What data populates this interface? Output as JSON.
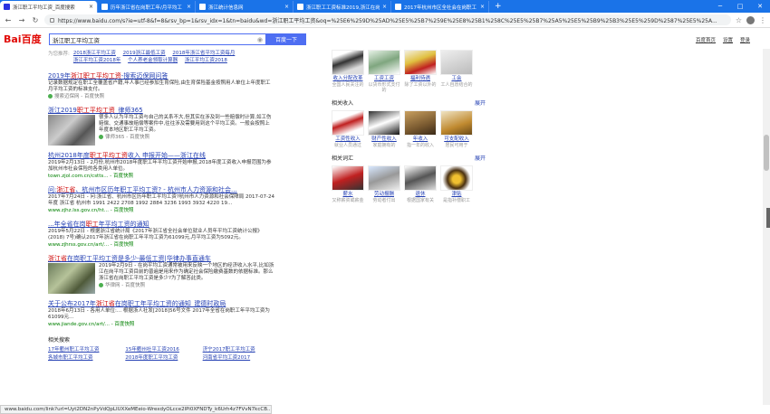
{
  "tabs": [
    {
      "title": "浙江职工平均工资_百度搜索",
      "active": true
    },
    {
      "title": "历年浙江省在岗职工年/月平均工",
      "active": false
    },
    {
      "title": "浙江统计信息网",
      "active": false
    },
    {
      "title": "浙江职工工资标准2019,浙江在岗",
      "active": false
    },
    {
      "title": "2017年杭州市区全社会在岗职工",
      "active": false
    }
  ],
  "new_tab": "+",
  "address": {
    "url": "https://www.baidu.com/s?ie=utf-8&f=8&rsv_bp=1&rsv_idx=1&tn=baidu&wd=浙江职工平均工资&oq=%25E6%259D%25AD%25E5%25B7%259E%25E8%25B1%258C%25E5%25B7%25A5%25E5%25B9%25B3%25E5%259D%2587%25E5%25A..."
  },
  "search": {
    "logo": "Bai百度",
    "query": "浙江职工平均工资",
    "button": "百度一下",
    "header_links": [
      "百度首页",
      "设置",
      "登录"
    ]
  },
  "related_top": {
    "label": "为您推荐:",
    "links": [
      "2018浙江平均工资",
      "2019浙江最低工资",
      "2018年浙江省平均工资每月",
      "浙江平均工资2018年",
      "个人养老金领取计算器",
      "浙江平均工资2018"
    ]
  },
  "results": [
    {
      "title_pre": "2019年",
      "title_em": "浙江职工平均工资",
      "title_post": "-搜索迈保网问答",
      "desc": "记录数据规定在职工全覆盖省户籍,年人事已经参加生育保险,由生育保险基金按照用人单位上年度职工月平均工资的标准支付。",
      "meta": "搜索迈保网 - 百度快照",
      "thumb": ""
    },
    {
      "title_pre": "浙江2019",
      "title_em": "职工平均工资",
      "title_post": "_律师365",
      "desc": "很多人认为平均工资与自己的关系不大,但其实在涉及到一些赔偿时计算,如工伤赔偿、交通事故赔偿等案件中,往往涉及需要用到这个平均工资。一般会按照上年度本地区职工平均工资。",
      "meta": "律师365 - 百度快照",
      "thumb": "a"
    },
    {
      "title_pre": "杭州2018年度",
      "title_em": "职工平均工资",
      "title_post": "收入 申报开始——浙江在线",
      "desc": "2019年2月13日 - 2月份,杭州市2018年度职工年平均工资开始申报,2018年度工资收入申报范围为参加杭州市社会保险的各类用人单位。",
      "meta": "town.zjol.com.cn/cstts... - 百度快照",
      "thumb": ""
    },
    {
      "title_pre": "问:",
      "title_em": "浙江省",
      "title_post": "、杭州市区历年职工平均工资? - 杭州市人力资源和社会...",
      "desc": "2017年7月24日 - 问:浙江省、杭州市区历年职工平均工资?杭州市人力资源和社会保障局 2017-07-24 年度 浙江省 杭州市 1991 2422 2708 1992 2884 3236 1993 3932 4220 19...",
      "meta": "www.zjhz.lss.gov.cn/ht... - 百度快照",
      "thumb": ""
    },
    {
      "title_pre": "...年全省在岗",
      "title_em": "职工",
      "title_post": "年平均工资的通知",
      "desc": "2019年5月22日 - 根据浙江省统计局《2017年浙江省全社会单位就业人员年平均工资统计公报》(2018) 7号)确认2017年浙江省在岗职工年平均工资为61099元,月平均工资为5092元。",
      "meta": "www.zjhrss.gov.cn/art/... - 百度快照",
      "thumb": ""
    },
    {
      "title_pre": "",
      "title_em": "浙江省",
      "title_post": "在岗职工平均工资是多少-最低工资|华律办事直通车",
      "desc": "2019年2月9日 - 在岗平均工资通常被用来反映一个地区的经济收入水平,比如浙江在岗平均工资目前的普遍是用来作为确定社会保险缴费基数的依据标准。那么浙江省在岗职工平均工资是多少?为了解答此类。",
      "meta": "华律网 - 百度快照",
      "thumb": "b"
    },
    {
      "title_pre": "关于公布2017年",
      "title_em": "浙江省",
      "title_post": "在岗职工年平均工资的通知_建德时政局",
      "desc": "2018年6月13日 - 各用人单位:... 根据浙人社发[2018]56号文件 2017年全省在岗职工年平均工资为61099元...",
      "meta": "www.jiande.gov.cn/art/... - 百度快照",
      "thumb": ""
    }
  ],
  "related_search": {
    "heading": "相关搜索",
    "links": [
      "17年衢州职工平均工资",
      "15年衢州社平工资2016",
      "济宁2017职工平均工资",
      "各城市职工平均工资",
      "2018年度职工平均工资",
      "河南省平均工资2017"
    ]
  },
  "right_panel": {
    "top_row": [
      {
        "name": "收入分配改革",
        "desc": "全国人民关注的"
      },
      {
        "name": "工资工资",
        "desc": "以货币形式支付的"
      },
      {
        "name": "福利待遇",
        "desc": "除了工资以外的"
      },
      {
        "name": "工会",
        "desc": "工人自愿结合的"
      }
    ],
    "income": {
      "heading": "相关收入",
      "more": "展开",
      "items": [
        {
          "name": "工资性收入",
          "desc": "就业人员通过"
        },
        {
          "name": "财产性收入",
          "desc": "家庭拥有的"
        },
        {
          "name": "年收入",
          "desc": "指一年的收入"
        },
        {
          "name": "可支配收入",
          "desc": "居民可用于"
        }
      ]
    },
    "terms": {
      "heading": "相关词汇",
      "more": "展开",
      "items": [
        {
          "name": "薪水",
          "desc": "又称薪资或薪金"
        },
        {
          "name": "劳动报酬",
          "desc": "劳动者付出"
        },
        {
          "name": "退休",
          "desc": "根据国家有关"
        },
        {
          "name": "津贴",
          "desc": "是指补偿职工"
        }
      ]
    }
  },
  "status_url": "www.baidu.com/link?url=Uyt2DN2nPyVdQpLIUXXeMEeio-WrexdyOLcce2lPi0XFNDTy_k6Urh4z7FVvN7kcCB..."
}
